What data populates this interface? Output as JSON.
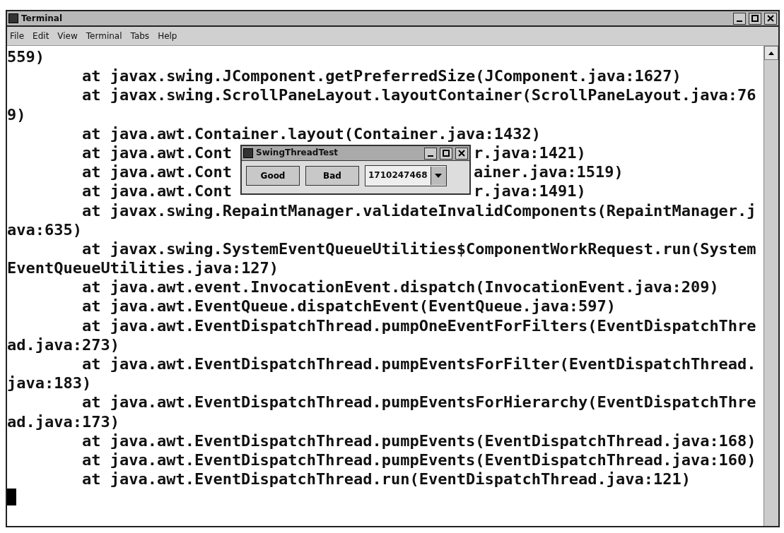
{
  "window": {
    "title": "Terminal"
  },
  "menu": [
    "File",
    "Edit",
    "View",
    "Terminal",
    "Tabs",
    "Help"
  ],
  "lines": [
    {
      "kind": "wrap",
      "text": "559)"
    },
    {
      "kind": "frame",
      "text": "at javax.swing.JComponent.getPreferredSize(JComponent.java:1627)"
    },
    {
      "kind": "frame",
      "text": "at javax.swing.ScrollPaneLayout.layoutContainer(ScrollPaneLayout.java:76"
    },
    {
      "kind": "wrap",
      "text": "9)"
    },
    {
      "kind": "frame",
      "text": "at java.awt.Container.layout(Container.java:1432)"
    },
    {
      "kind": "frame",
      "text": "at java.awt.Cont",
      "tail": "r.java:1421)"
    },
    {
      "kind": "frame",
      "text": "at java.awt.Cont",
      "tail": "ainer.java:1519)"
    },
    {
      "kind": "frame",
      "text": "at java.awt.Cont",
      "tail": "r.java:1491)"
    },
    {
      "kind": "frame",
      "text": "at javax.swing.RepaintManager.validateInvalidComponents(RepaintManager.j"
    },
    {
      "kind": "wrap",
      "text": "ava:635)"
    },
    {
      "kind": "frame",
      "text": "at javax.swing.SystemEventQueueUtilities$ComponentWorkRequest.run(System"
    },
    {
      "kind": "wrap",
      "text": "EventQueueUtilities.java:127)"
    },
    {
      "kind": "frame",
      "text": "at java.awt.event.InvocationEvent.dispatch(InvocationEvent.java:209)"
    },
    {
      "kind": "frame",
      "text": "at java.awt.EventQueue.dispatchEvent(EventQueue.java:597)"
    },
    {
      "kind": "frame",
      "text": "at java.awt.EventDispatchThread.pumpOneEventForFilters(EventDispatchThre"
    },
    {
      "kind": "wrap",
      "text": "ad.java:273)"
    },
    {
      "kind": "frame",
      "text": "at java.awt.EventDispatchThread.pumpEventsForFilter(EventDispatchThread."
    },
    {
      "kind": "wrap",
      "text": "java:183)"
    },
    {
      "kind": "frame",
      "text": "at java.awt.EventDispatchThread.pumpEventsForHierarchy(EventDispatchThre"
    },
    {
      "kind": "wrap",
      "text": "ad.java:173)"
    },
    {
      "kind": "frame",
      "text": "at java.awt.EventDispatchThread.pumpEvents(EventDispatchThread.java:168)"
    },
    {
      "kind": "frame",
      "text": "at java.awt.EventDispatchThread.pumpEvents(EventDispatchThread.java:160)"
    },
    {
      "kind": "frame",
      "text": "at java.awt.EventDispatchThread.run(EventDispatchThread.java:121)"
    }
  ],
  "dialog": {
    "title": "SwingThreadTest",
    "buttons": [
      "Good",
      "Bad"
    ],
    "combo": {
      "value": "1710247468"
    }
  }
}
